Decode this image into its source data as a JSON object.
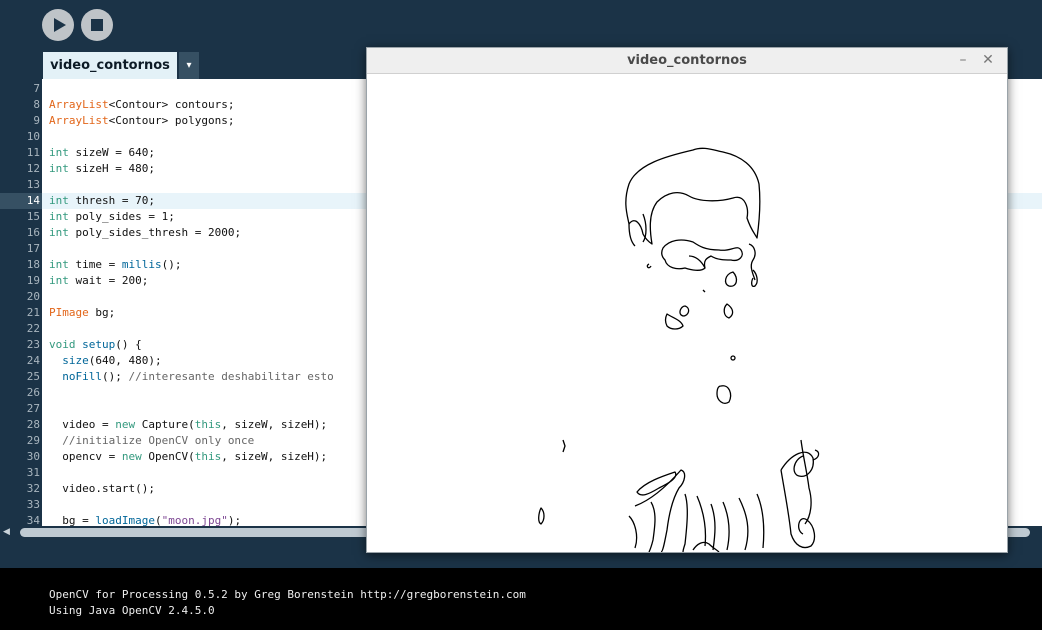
{
  "toolbar": {
    "run_icon": "play-icon",
    "stop_icon": "stop-icon"
  },
  "tab": {
    "label": "video_contornos",
    "dropdown_glyph": "▾"
  },
  "editor": {
    "highlighted_line": "14",
    "lines": [
      {
        "n": "7",
        "t": ""
      },
      {
        "n": "8",
        "t": "ArrayList<Contour> contours;"
      },
      {
        "n": "9",
        "t": "ArrayList<Contour> polygons;"
      },
      {
        "n": "10",
        "t": ""
      },
      {
        "n": "11",
        "t": "int sizeW = 640;"
      },
      {
        "n": "12",
        "t": "int sizeH = 480;"
      },
      {
        "n": "13",
        "t": ""
      },
      {
        "n": "14",
        "t": "int thresh = 70;"
      },
      {
        "n": "15",
        "t": "int poly_sides = 1;"
      },
      {
        "n": "16",
        "t": "int poly_sides_thresh = 2000;"
      },
      {
        "n": "17",
        "t": ""
      },
      {
        "n": "18",
        "t": "int time = millis();"
      },
      {
        "n": "19",
        "t": "int wait = 200;"
      },
      {
        "n": "20",
        "t": ""
      },
      {
        "n": "21",
        "t": "PImage bg;"
      },
      {
        "n": "22",
        "t": ""
      },
      {
        "n": "23",
        "t": "void setup() {"
      },
      {
        "n": "24",
        "t": "  size(640, 480);"
      },
      {
        "n": "25",
        "t": "  noFill(); //interesante deshabilitar esto"
      },
      {
        "n": "26",
        "t": ""
      },
      {
        "n": "27",
        "t": ""
      },
      {
        "n": "28",
        "t": "  video = new Capture(this, sizeW, sizeH);"
      },
      {
        "n": "29",
        "t": "  //initialize OpenCV only once"
      },
      {
        "n": "30",
        "t": "  opencv = new OpenCV(this, sizeW, sizeH);"
      },
      {
        "n": "31",
        "t": ""
      },
      {
        "n": "32",
        "t": "  video.start();"
      },
      {
        "n": "33",
        "t": ""
      },
      {
        "n": "34",
        "t": "  bg = loadImage(\"moon.jpg\");"
      }
    ]
  },
  "console": {
    "lines": [
      "OpenCV for Processing 0.5.2 by Greg Borenstein http://gregborenstein.com",
      "Using Java OpenCV 2.4.5.0"
    ]
  },
  "sketch_window": {
    "title": "video_contornos",
    "minimize_glyph": "–",
    "close_glyph": "✕",
    "canvas_content": "contour-drawing"
  },
  "colors": {
    "chrome_bg": "#1b3347",
    "tab_bg": "#e3f1f7",
    "keyword": "#33997e",
    "type": "#e2661a",
    "function": "#006699"
  }
}
